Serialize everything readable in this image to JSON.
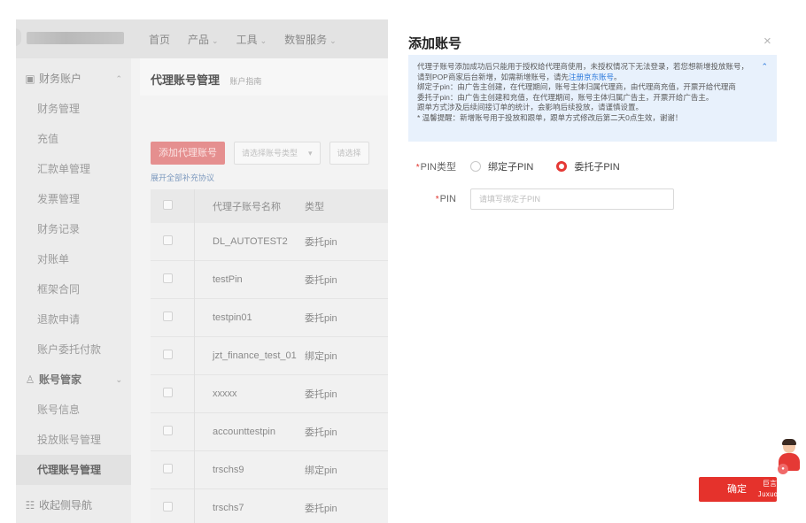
{
  "topnav": {
    "items": [
      {
        "label": "首页",
        "caret": ""
      },
      {
        "label": "产品",
        "caret": "⌄"
      },
      {
        "label": "工具",
        "caret": "⌄"
      },
      {
        "label": "数智服务",
        "caret": "⌄"
      }
    ]
  },
  "sidebar": {
    "finance_group": "财务账户",
    "finance_items": [
      "财务管理",
      "充值",
      "汇款单管理",
      "发票管理",
      "财务记录",
      "对账单",
      "框架合同",
      "退款申请",
      "账户委托付款"
    ],
    "account_group": "账号管家",
    "account_items": [
      "账号信息",
      "投放账号管理",
      "代理账号管理"
    ],
    "collapse_label": "收起侧导航"
  },
  "main": {
    "page_title": "代理账号管理",
    "page_subtitle": "账户指南",
    "add_button": "添加代理账号",
    "type_select_placeholder": "请选择账号类型",
    "second_select_placeholder": "请选择",
    "expand_link": "展开全部补充协议",
    "table": {
      "columns": [
        "代理子账号名称",
        "类型"
      ],
      "rows": [
        {
          "name": "DL_AUTOTEST2",
          "type": "委托pin"
        },
        {
          "name": "testPin",
          "type": "委托pin"
        },
        {
          "name": "testpin01",
          "type": "委托pin"
        },
        {
          "name": "jzt_finance_test_01",
          "type": "绑定pin"
        },
        {
          "name": "xxxxx",
          "type": "委托pin"
        },
        {
          "name": "accounttestpin",
          "type": "委托pin"
        },
        {
          "name": "trschs9",
          "type": "绑定pin"
        },
        {
          "name": "trschs7",
          "type": "委托pin"
        }
      ]
    }
  },
  "drawer": {
    "title": "添加账号",
    "close_icon": "×",
    "notice": {
      "line1": "代理子账号添加成功后只能用于授权给代理商使用，未授权情况下无法登录，若您想新增投放账号，",
      "line2_prefix": "请到POP商家后台新增，如需新增账号，请先",
      "line2_link": "注册京东账号",
      "line2_suffix": "。",
      "line3": "绑定子pin：由广告主创建，在代理期间，账号主体归属代理商，由代理商充值，开票开给代理商",
      "line4": "委托子pin：由广告主创建和充值，在代理期间，账号主体归属广告主，开票开给广告主。",
      "line5": "跟单方式涉及后续间接订单的统计，会影响后续投放，请谨慎设置。",
      "line6": "* 温馨提醒：新增账号用于投放和跟单，跟单方式修改后第二天0点生效，谢谢！",
      "collapse": "⌃"
    },
    "pin_type_label": "PIN类型",
    "pin_type_options": [
      "绑定子PIN",
      "委托子PIN"
    ],
    "pin_type_selected": "委托子PIN",
    "pin_label": "PIN",
    "pin_placeholder": "请填写绑定子PIN",
    "confirm_button": "确定"
  },
  "watermark": {
    "cn": "巨言",
    "en": "Juxuon"
  },
  "colors": {
    "accent": "#e5322c",
    "notice_bg": "#e8f1fc",
    "link": "#2f7bdc"
  }
}
